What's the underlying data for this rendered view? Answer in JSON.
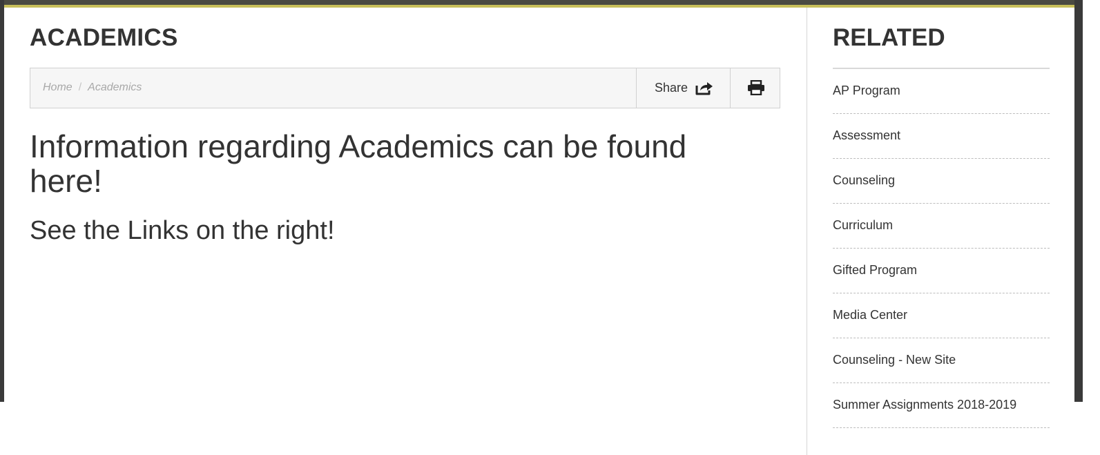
{
  "page": {
    "title": "ACADEMICS"
  },
  "breadcrumb": {
    "items": [
      {
        "label": "Home"
      },
      {
        "label": "Academics"
      }
    ],
    "separator": "/"
  },
  "toolbar": {
    "share_label": "Share",
    "share_icon": "share-arrow-icon",
    "print_icon": "printer-icon"
  },
  "content": {
    "heading": "Information regarding Academics can be found here!",
    "subheading": "See the Links on the right!"
  },
  "sidebar": {
    "title": "RELATED",
    "items": [
      {
        "label": "AP Program"
      },
      {
        "label": "Assessment"
      },
      {
        "label": "Counseling"
      },
      {
        "label": "Curriculum"
      },
      {
        "label": "Gifted Program"
      },
      {
        "label": "Media Center"
      },
      {
        "label": "Counseling - New Site"
      },
      {
        "label": "Summer Assignments 2018-2019"
      }
    ]
  },
  "colors": {
    "accent": "#c8bf5a",
    "frame": "#3a3a3a",
    "text": "#333333",
    "toolbar_bg": "#f6f6f6"
  }
}
